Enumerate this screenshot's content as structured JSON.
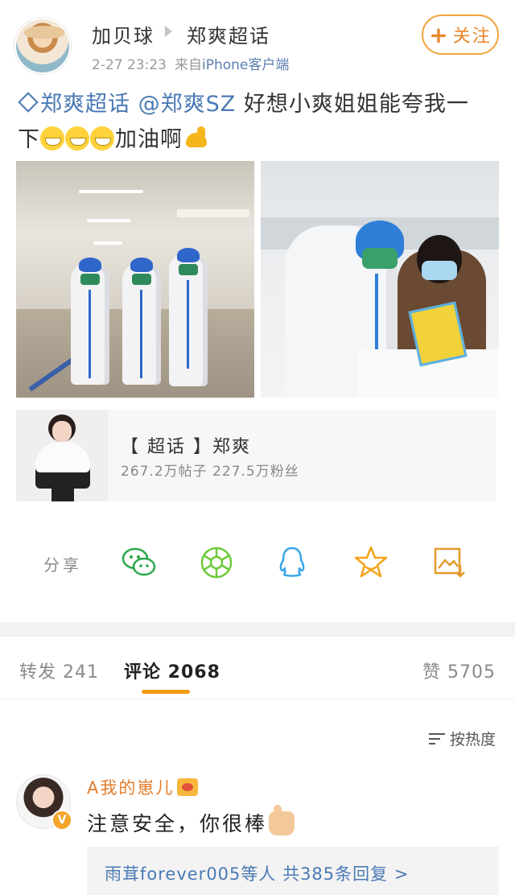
{
  "post": {
    "author": "加贝球",
    "topic": "郑爽超话",
    "time": "2-27 23:23",
    "source_prefix": "来自",
    "source_device": "iPhone客户端",
    "follow_label": "关注",
    "text": {
      "topic_link": "郑爽超话",
      "mention": "@郑爽SZ",
      "body_line1": " 好想小爽姐姐能夸我一",
      "body_line2": "下",
      "body_tail": "加油啊"
    }
  },
  "topic_card": {
    "title": "【 超话 】郑爽",
    "stats": "267.2万帖子 227.5万粉丝"
  },
  "share": {
    "label": "分享",
    "targets": [
      "wechat-icon",
      "moments-icon",
      "qq-icon",
      "favorite-star-icon",
      "save-image-icon"
    ]
  },
  "tabs": {
    "repost": "转发 241",
    "comment": "评论 2068",
    "like": "赞 5705"
  },
  "sort": {
    "label": "按热度"
  },
  "comment": {
    "user": "A我的崽儿",
    "text": "注意安全，你很棒",
    "replies": "雨茸forever005等人 共385条回复 >"
  },
  "colors": {
    "accent_orange": "#f39c12",
    "link_blue": "#4a79b5",
    "username_orange": "#e57d2c"
  }
}
